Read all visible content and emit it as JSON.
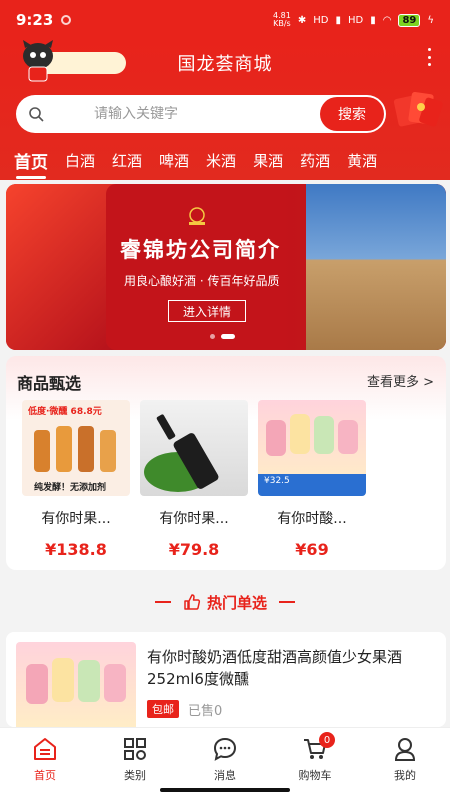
{
  "status_bar": {
    "time": "9:23",
    "net_speed": "4.81\nKB/s",
    "signal1": "HD",
    "signal2": "HD",
    "battery": "89"
  },
  "header": {
    "title": "国龙荟商城"
  },
  "search": {
    "placeholder": "请输入关键字",
    "button_label": "搜索"
  },
  "tabs": [
    "首页",
    "白酒",
    "红酒",
    "啤酒",
    "米酒",
    "果酒",
    "药酒",
    "黄酒"
  ],
  "banner": {
    "title": "睿锦坊公司简介",
    "subtitle": "用良心酿好酒 · 传百年好品质",
    "button_label": "进入详情"
  },
  "featured": {
    "title": "商品甄选",
    "more_label": "查看更多 >",
    "products": [
      {
        "name": "有你时果...",
        "price": "¥138.8",
        "img_text": "低度·微醺 68.8元",
        "img_sub": "纯发酵！无添加剂"
      },
      {
        "name": "有你时果...",
        "price": "¥79.8"
      },
      {
        "name": "有你时酸...",
        "price": "¥69",
        "img_price": "¥32.5"
      }
    ]
  },
  "hot": {
    "heading": "热门单选",
    "item": {
      "title": "有你时酸奶酒低度甜酒高颜值少女果酒252ml6度微醺",
      "tag": "包邮",
      "sold": "已售0"
    }
  },
  "bottom_nav": [
    {
      "label": "首页",
      "icon": "home-icon"
    },
    {
      "label": "类别",
      "icon": "category-icon"
    },
    {
      "label": "消息",
      "icon": "message-icon"
    },
    {
      "label": "购物车",
      "icon": "cart-icon",
      "badge": "0"
    },
    {
      "label": "我的",
      "icon": "profile-icon"
    }
  ],
  "colors": {
    "primary": "#e8231b",
    "background": "#f3f3f3"
  }
}
